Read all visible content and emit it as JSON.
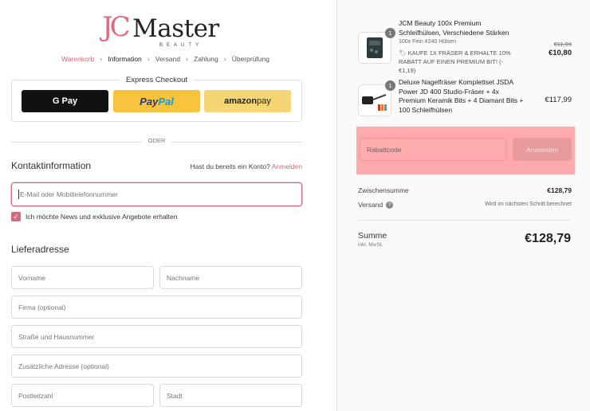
{
  "brand": {
    "mark": "JC",
    "name": "Master",
    "sub": "BEAUTY"
  },
  "breadcrumb": [
    {
      "label": "Warenkorb",
      "state": "link"
    },
    {
      "label": "Information",
      "state": "current"
    },
    {
      "label": "Versand",
      "state": "pending"
    },
    {
      "label": "Zahlung",
      "state": "pending"
    },
    {
      "label": "Überprüfung",
      "state": "pending"
    }
  ],
  "express": {
    "title": "Express Checkout",
    "gpay": "G Pay",
    "paypal_pay": "Pay",
    "paypal_pal": "Pal",
    "amazon_bold": "amazon",
    "amazon_rest": " pay"
  },
  "divider_text": "ODER",
  "contact": {
    "title": "Kontaktinformation",
    "account_prompt": "Hast du bereits ein Konto?",
    "login_link": "Anmelden",
    "email_placeholder": "E-Mail oder Mobiltelefonnummer",
    "newsletter_label": "Ich möchte News und exklusive Angebote erhalten",
    "newsletter_checked": true
  },
  "shipping": {
    "title": "Lieferadresse",
    "first_name": "Vorname",
    "last_name": "Nachname",
    "company": "Firma (optional)",
    "street": "Straße und Hausnummer",
    "address2": "Zusätzliche Adresse (optional)",
    "zip": "Postleitzahl",
    "city": "Stadt"
  },
  "cart": {
    "items": [
      {
        "qty": "1",
        "name_lines": [
          "JCM Beauty 100x Premium",
          "Schleifhülsen, Verschiedene Stärken"
        ],
        "variant": "100x Fein #240 Hülsen",
        "discount_lines": [
          "KAUFE 1X FRÄSER & ERHALTE 10%",
          "RABATT AUF EINEN PREMIUM BIT! (-",
          "€1,19)"
        ],
        "old_price": "€11,99",
        "price": "€10,80"
      },
      {
        "qty": "1",
        "name_lines": [
          "Deluxe Nagelfräser Komplettset JSDA",
          "Power JD 400 Studio-Fräser + 4x",
          "Premium Keramik Bits + 4 Diamant Bits +",
          "100 Schleifhülsen"
        ],
        "price": "€117,99"
      }
    ],
    "discount_placeholder": "Rabattcode",
    "apply_label": "Anwenden",
    "subtotal_label": "Zwischensumme",
    "subtotal_value": "€128,79",
    "shipping_label": "Versand",
    "shipping_value": "Wird im nächsten Schritt berechnet",
    "total_label": "Summe",
    "total_sub": "inkl. MwSt.",
    "total_value": "€128,79"
  },
  "colors": {
    "accent": "#d06b7a",
    "highlight": "#ffaaaa"
  }
}
